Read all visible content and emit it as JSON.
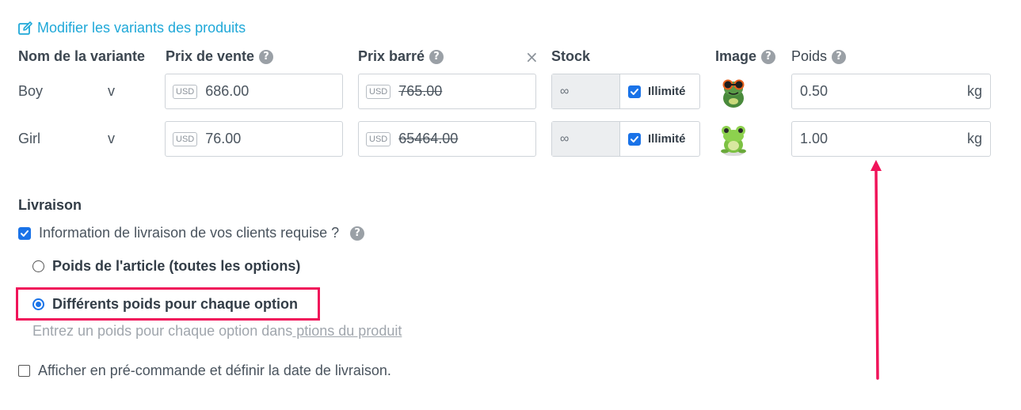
{
  "edit_link": {
    "label": "Modifier les variants des produits",
    "icon": "edit-icon"
  },
  "columns": {
    "name": "Nom de la variante",
    "price": "Prix de vente",
    "strike_price": "Prix barré",
    "stock": "Stock",
    "image": "Image",
    "weight": "Poids",
    "clear_icon": "×"
  },
  "variants": [
    {
      "name": "Boy",
      "option": "v",
      "currency": "USD",
      "price": "686.00",
      "strike_price": "765.00",
      "stock": "∞",
      "unlimited_label": "Illimité",
      "unlimited": true,
      "image": "frog-with-glasses",
      "weight": "0.50",
      "unit": "kg"
    },
    {
      "name": "Girl",
      "option": "v",
      "currency": "USD",
      "price": "76.00",
      "strike_price": "65464.00",
      "stock": "∞",
      "unlimited_label": "Illimité",
      "unlimited": true,
      "image": "green-frog",
      "weight": "1.00",
      "unit": "kg"
    }
  ],
  "shipping": {
    "title": "Livraison",
    "info_required": {
      "label": "Information de livraison de vos clients requise ?",
      "checked": true
    },
    "options": [
      {
        "label": "Poids de l'article (toutes les options)",
        "selected": false
      },
      {
        "label": "Différents poids pour chaque option",
        "selected": true
      }
    ],
    "hint_text": "Entrez un poids pour chaque option dans",
    "hint_link": " ptions du produit",
    "preorder": {
      "label": "Afficher en pré-commande et définir la date de livraison.",
      "checked": false
    }
  },
  "colors": {
    "accent": "#1fa8d8",
    "checkbox": "#1a73e8",
    "annotation": "#f0145a"
  }
}
